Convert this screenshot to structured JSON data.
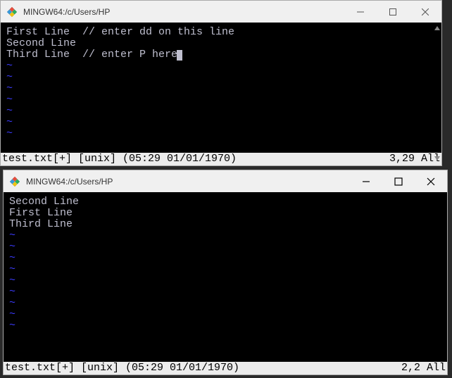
{
  "windows": [
    {
      "title": "MINGW64:/c/Users/HP",
      "lines": [
        "First Line  // enter dd on this line",
        "Second Line",
        "Third Line  // enter P here"
      ],
      "cursor_at_end_of": 2,
      "tildes": 7,
      "status": {
        "left": "test.txt[+] [unix] (05:29 01/01/1970)",
        "right": "3,29 All"
      }
    },
    {
      "title": "MINGW64:/c/Users/HP",
      "lines": [
        "Second Line",
        "First Line",
        "Third Line"
      ],
      "cursor_at_end_of": -1,
      "tildes": 9,
      "status": {
        "left": "test.txt[+] [unix] (05:29 01/01/1970)",
        "right": "2,2 All"
      }
    }
  ],
  "icons": {
    "app": "mingw",
    "min": "minimize",
    "max": "maximize",
    "close": "close"
  }
}
